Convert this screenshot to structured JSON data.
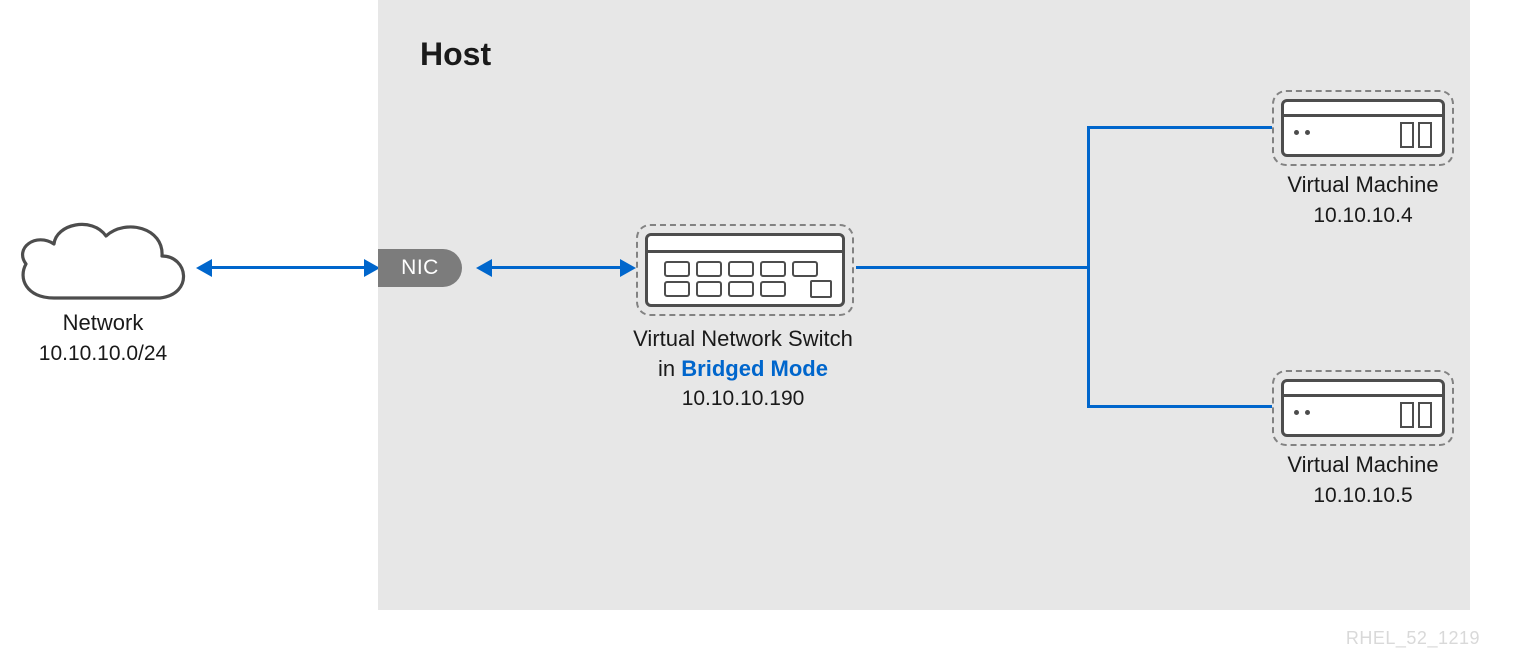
{
  "host_title": "Host",
  "nic_label": "NIC",
  "network": {
    "label": "Network",
    "cidr": "10.10.10.0/24"
  },
  "switch": {
    "line1": "Virtual Network Switch",
    "line2_prefix": "in ",
    "line2_highlight": "Bridged Mode",
    "ip": "10.10.10.190"
  },
  "vm1": {
    "label": "Virtual Machine",
    "ip": "10.10.10.4"
  },
  "vm2": {
    "label": "Virtual Machine",
    "ip": "10.10.10.5"
  },
  "footer_code": "RHEL_52_1219",
  "colors": {
    "link": "#0066cc",
    "highlight": "#0066cc",
    "host_bg": "#e7e7e7",
    "nic_bg": "#7c7c7c",
    "stroke": "#4d4d4d",
    "dash": "#828282"
  }
}
